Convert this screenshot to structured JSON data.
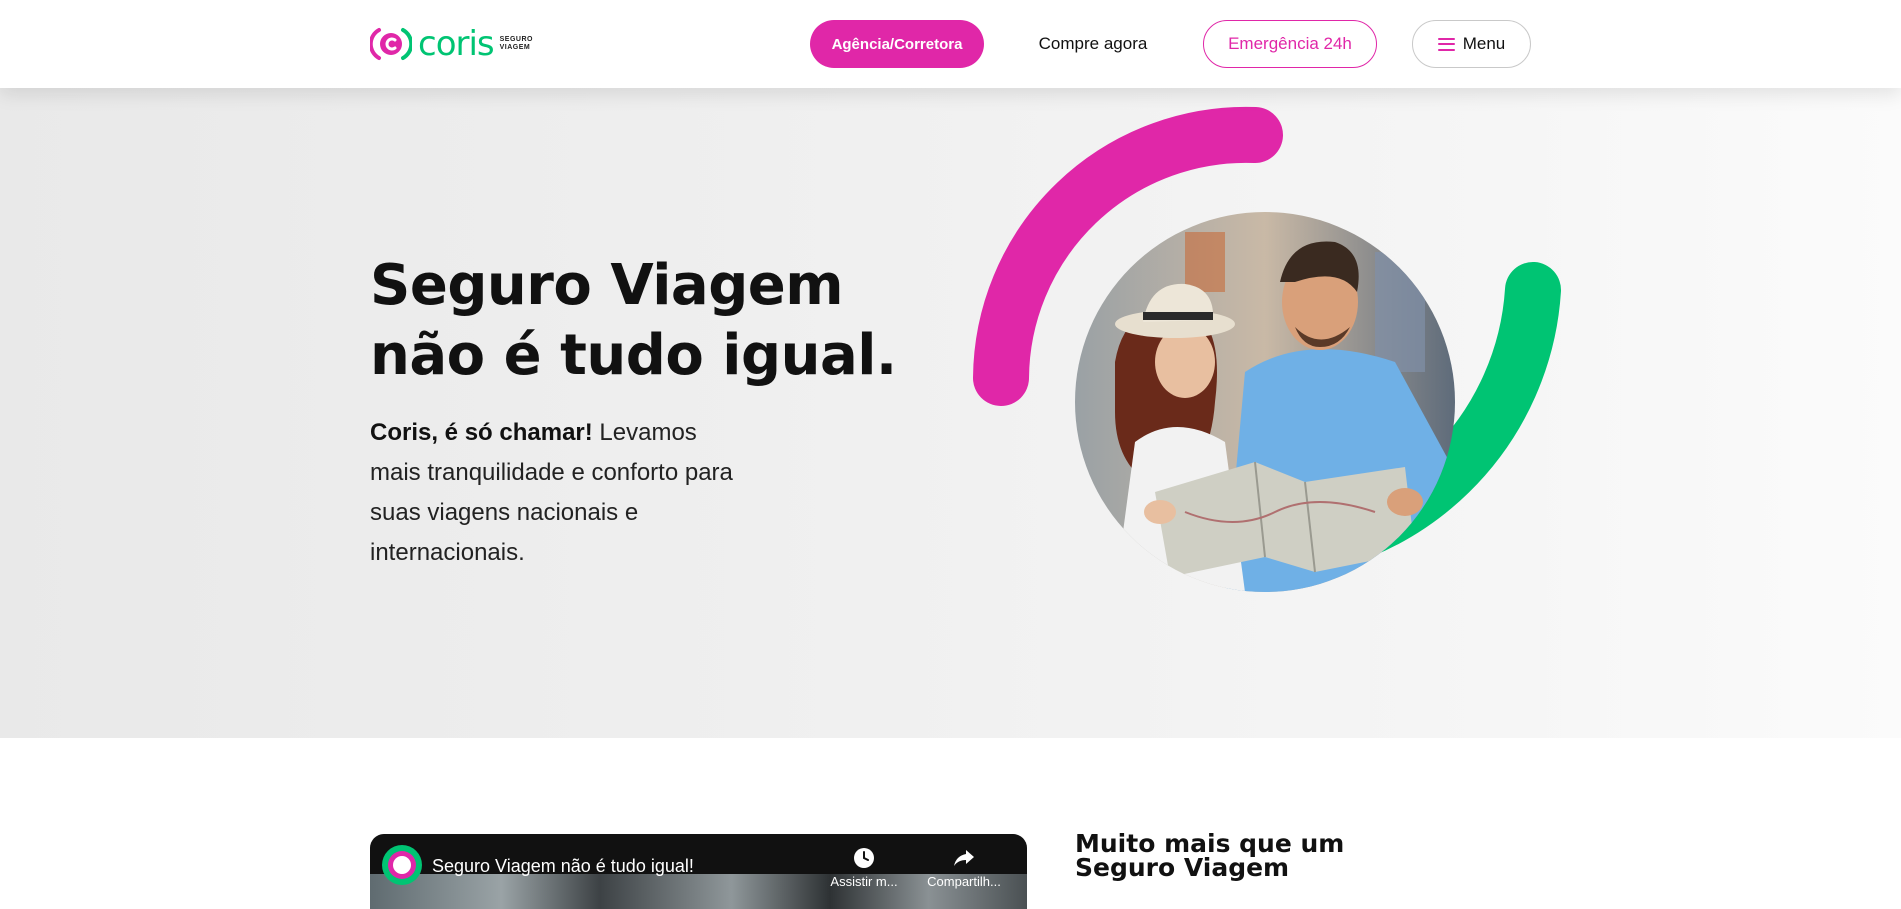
{
  "header": {
    "logo": {
      "word": "coris",
      "tag_line1": "SEGURO",
      "tag_line2": "VIAGEM"
    },
    "nav": {
      "agencia_label": "Agência/Corretora",
      "compre_label": "Compre agora",
      "emergencia_label": "Emergência 24h",
      "menu_label": "Menu"
    }
  },
  "hero": {
    "title_line1": "Seguro Viagem",
    "title_line2": "não é tudo igual.",
    "text_bold": "Coris, é só chamar!",
    "text_rest": " Levamos mais tranquilidade e conforto para suas viagens nacionais e internacionais."
  },
  "video": {
    "title": "Seguro Viagem não é tudo igual!",
    "watch_label": "Assistir m...",
    "share_label": "Compartilh..."
  },
  "section": {
    "title": "Muito mais que um Seguro Viagem"
  },
  "colors": {
    "brand_pink": "#e027a8",
    "brand_green": "#00c473",
    "hero_bg": "#eeeeee"
  },
  "icons": [
    "hamburger-menu-icon",
    "clock-icon",
    "share-arrow-icon",
    "coris-logo-icon"
  ]
}
